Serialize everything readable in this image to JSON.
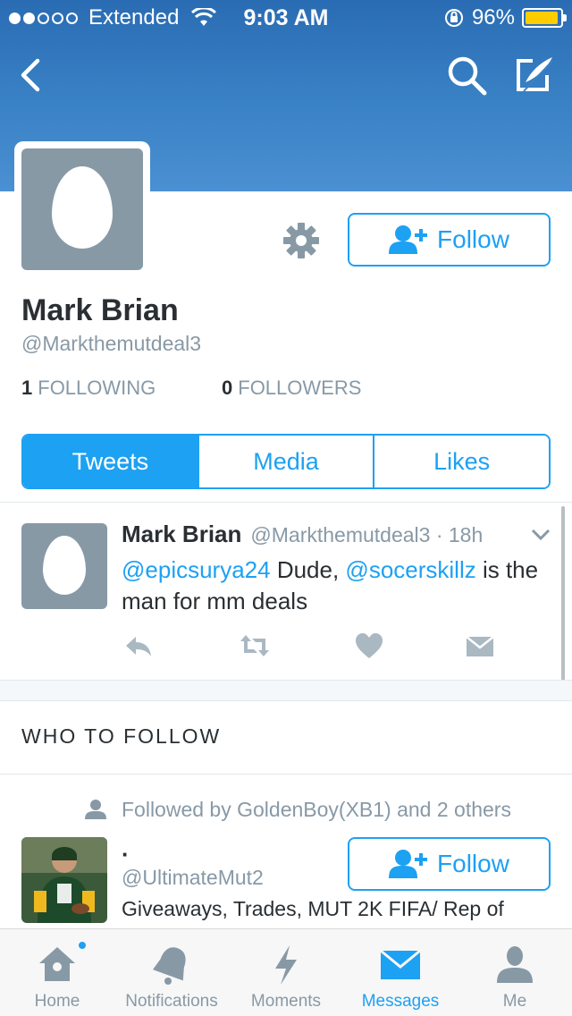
{
  "status_bar": {
    "carrier": "Extended",
    "time": "9:03 AM",
    "battery_percent": "96%",
    "battery_level": 0.96
  },
  "nav": {
    "back_icon": "chevron-left-icon",
    "search_icon": "search-icon",
    "compose_icon": "compose-icon"
  },
  "profile": {
    "name": "Mark Brian",
    "handle": "@Markthemutdeal3",
    "following_count": "1",
    "following_label": "FOLLOWING",
    "followers_count": "0",
    "followers_label": "FOLLOWERS",
    "follow_label": "Follow"
  },
  "tabs": [
    {
      "label": "Tweets",
      "active": true
    },
    {
      "label": "Media",
      "active": false
    },
    {
      "label": "Likes",
      "active": false
    }
  ],
  "tweet": {
    "name": "Mark Brian",
    "meta": "@Markthemutdeal3 · 18h",
    "mention1": "@epicsurya24",
    "text1": " Dude, ",
    "mention2": "@socerskillz",
    "text2": " is the man for mm deals"
  },
  "who_to_follow": {
    "title": "WHO TO FOLLOW",
    "followed_by": "Followed by GoldenBoy(XB1) and 2 others",
    "suggestion": {
      "name": "·",
      "handle": "@UltimateMut2",
      "bio": "Giveaways, Trades, MUT 2K FIFA/ Rep of",
      "follow_label": "Follow"
    }
  },
  "tab_bar": [
    {
      "label": "Home",
      "icon": "home-icon"
    },
    {
      "label": "Notifications",
      "icon": "bell-icon"
    },
    {
      "label": "Moments",
      "icon": "lightning-icon"
    },
    {
      "label": "Messages",
      "icon": "envelope-icon",
      "active": true
    },
    {
      "label": "Me",
      "icon": "person-icon"
    }
  ],
  "colors": {
    "accent": "#1da1f2",
    "muted": "#8899a6",
    "text": "#292f33",
    "banner": "#3a82c6"
  }
}
